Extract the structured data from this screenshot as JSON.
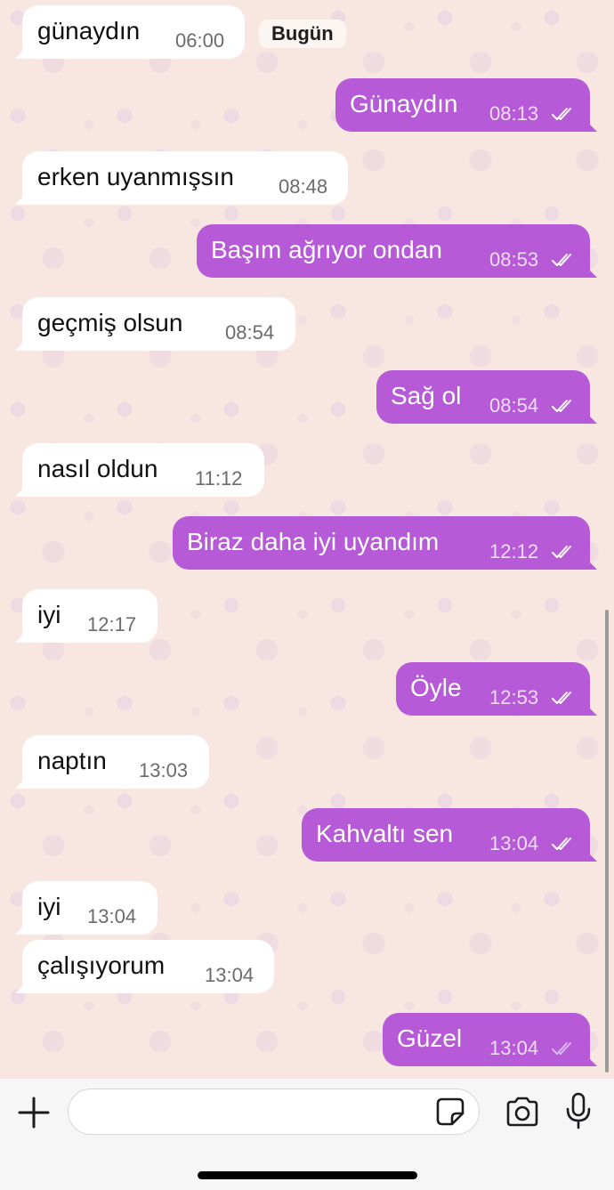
{
  "chat": {
    "date_label": "Bugün",
    "messages": [
      {
        "text": "günaydın",
        "time": "06:00",
        "dir": "in"
      },
      {
        "text": "Günaydın",
        "time": "08:13",
        "dir": "out",
        "read": true
      },
      {
        "text": "erken uyanmışsın",
        "time": "08:48",
        "dir": "in"
      },
      {
        "text": "Başım ağrıyor ondan",
        "time": "08:53",
        "dir": "out",
        "read": true
      },
      {
        "text": "geçmiş olsun",
        "time": "08:54",
        "dir": "in"
      },
      {
        "text": "Sağ ol",
        "time": "08:54",
        "dir": "out",
        "read": true
      },
      {
        "text": "nasıl oldun",
        "time": "11:12",
        "dir": "in"
      },
      {
        "text": "Biraz daha iyi uyandım",
        "time": "12:12",
        "dir": "out",
        "read": true
      },
      {
        "text": "iyi",
        "time": "12:17",
        "dir": "in"
      },
      {
        "text": "Öyle",
        "time": "12:53",
        "dir": "out",
        "read": true
      },
      {
        "text": "naptın",
        "time": "13:03",
        "dir": "in"
      },
      {
        "text": "Kahvaltı sen",
        "time": "13:04",
        "dir": "out",
        "read": true
      },
      {
        "text": "iyi",
        "time": "13:04",
        "dir": "in"
      },
      {
        "text": "çalışıyorum",
        "time": "13:04",
        "dir": "in"
      },
      {
        "text": "Güzel",
        "time": "13:04",
        "dir": "out",
        "read": false
      }
    ]
  },
  "input": {
    "placeholder": "",
    "icons": [
      "plus-icon",
      "sticker-icon",
      "camera-icon",
      "microphone-icon"
    ]
  },
  "colors": {
    "outgoing_bubble": "#b65ad8",
    "incoming_bubble": "#ffffff",
    "chat_background": "#f8e7e0",
    "read_ticks": "#ffffff",
    "unread_ticks": "#d9b8ea"
  }
}
